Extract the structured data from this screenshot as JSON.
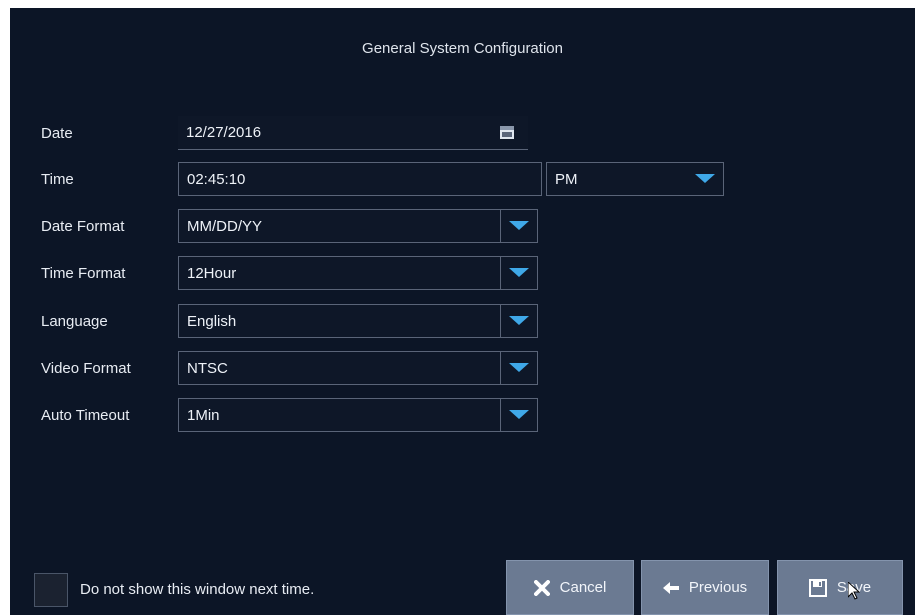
{
  "window": {
    "title": "General System Configuration"
  },
  "form": {
    "date": {
      "label": "Date",
      "value": "12/27/2016",
      "icon": "calendar-icon"
    },
    "time": {
      "label": "Time",
      "value": "02:45:10",
      "ampm": "PM"
    },
    "date_format": {
      "label": "Date Format",
      "value": "MM/DD/YY"
    },
    "time_format": {
      "label": "Time Format",
      "value": "12Hour"
    },
    "language": {
      "label": "Language",
      "value": "English"
    },
    "video_format": {
      "label": "Video Format",
      "value": "NTSC"
    },
    "auto_timeout": {
      "label": "Auto Timeout",
      "value": "1Min"
    }
  },
  "footer": {
    "checkbox_label": "Do not show this window next time.",
    "cancel_label": "Cancel",
    "previous_label": "Previous",
    "save_label": "Save"
  },
  "colors": {
    "background": "#0c1526",
    "button": "#6b7a92",
    "dropdown_accent": "#3fa8e8"
  }
}
